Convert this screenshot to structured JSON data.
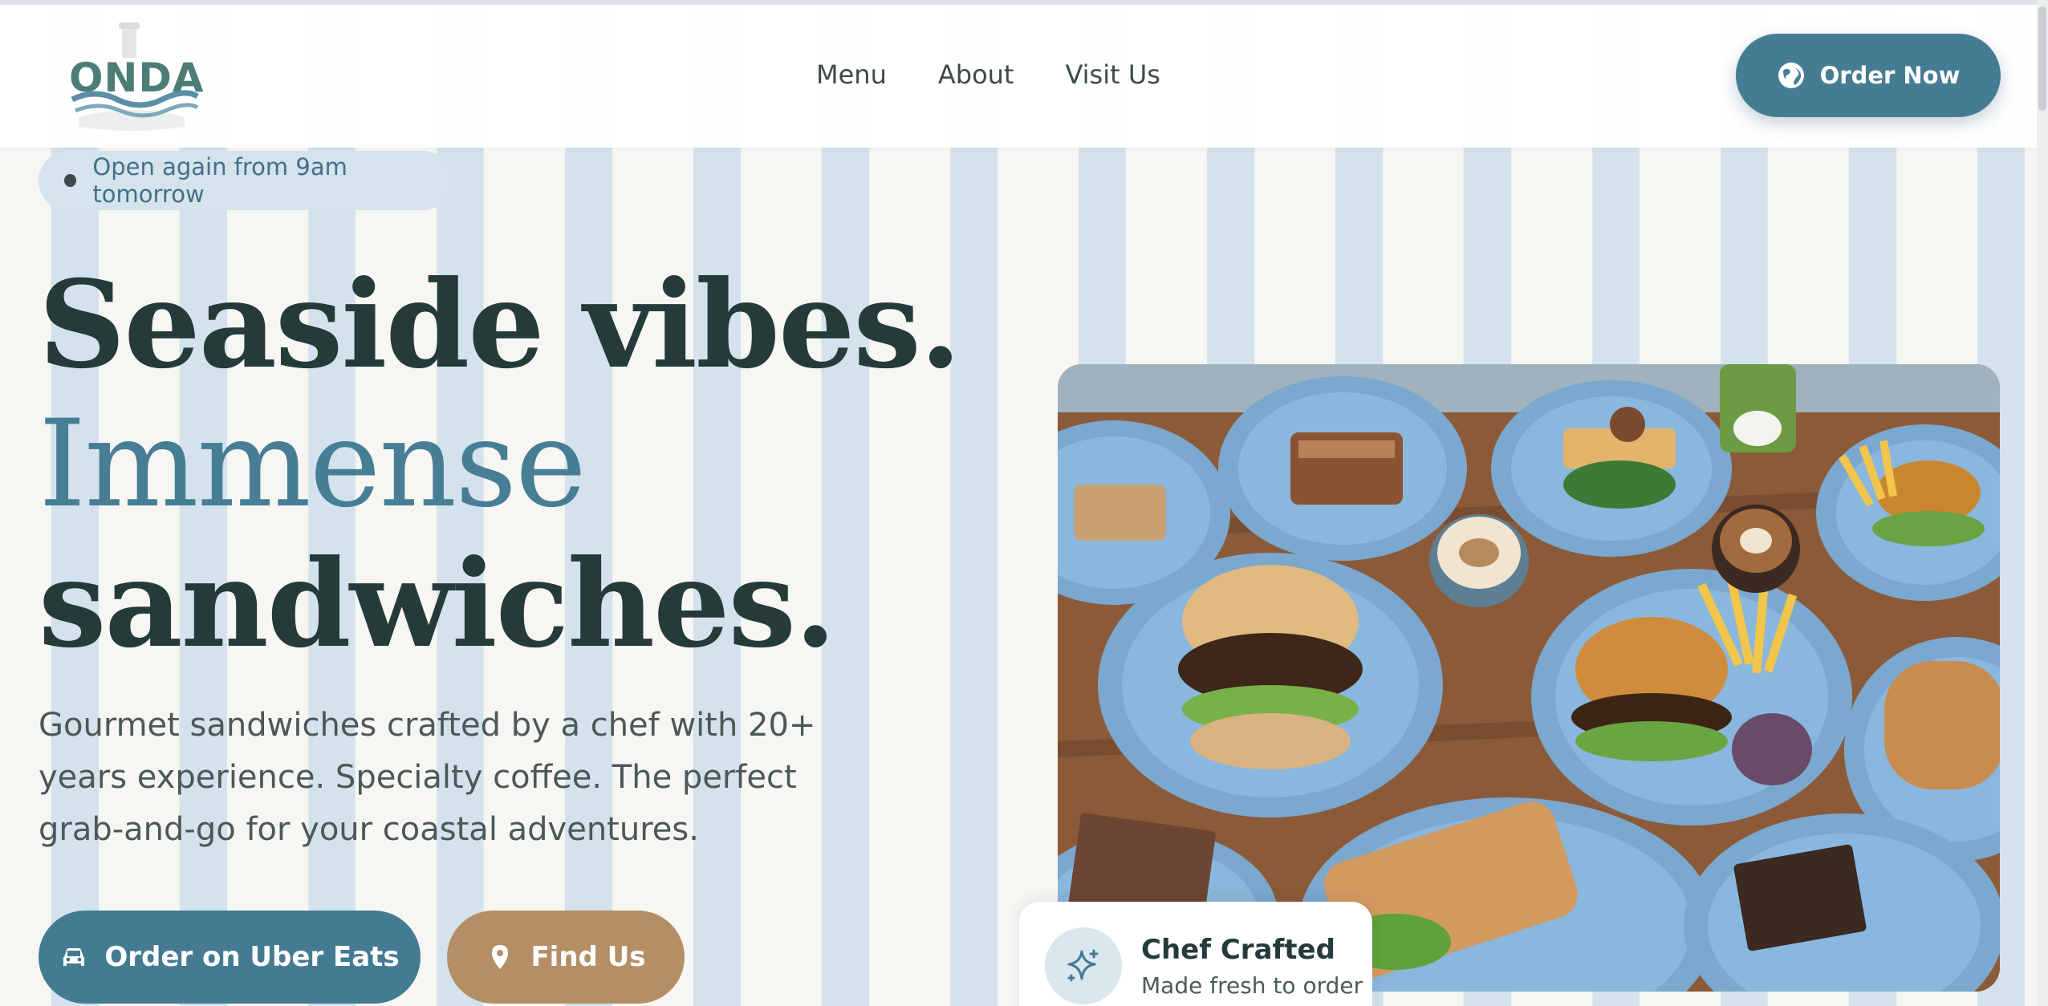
{
  "brand": {
    "logo_text": "ONDA"
  },
  "nav": {
    "items": [
      "Menu",
      "About",
      "Visit Us"
    ]
  },
  "header": {
    "order_now_label": "Order Now"
  },
  "status": {
    "text": "Open again from 9am tomorrow"
  },
  "hero": {
    "line1": "Seaside vibes.",
    "line2": "Immense",
    "line3": "sandwiches.",
    "description": "Gourmet sandwiches crafted by a chef with 20+ years experience. Specialty coffee. The perfect grab-and-go for your coastal adventures."
  },
  "cta": {
    "uber_label": "Order on Uber Eats",
    "find_label": "Find Us"
  },
  "badge": {
    "title": "Chef Crafted",
    "subtitle": "Made fresh to order"
  },
  "icons": {
    "order_now": "globe-icon",
    "uber": "car-icon",
    "find": "map-pin-icon",
    "badge": "sparkle-icon"
  },
  "colors": {
    "primary": "#467c93",
    "accent": "#b48f66",
    "heading_dark": "#243b39",
    "stripe_blue": "#d3e2ec",
    "background": "#f7f6f2"
  }
}
